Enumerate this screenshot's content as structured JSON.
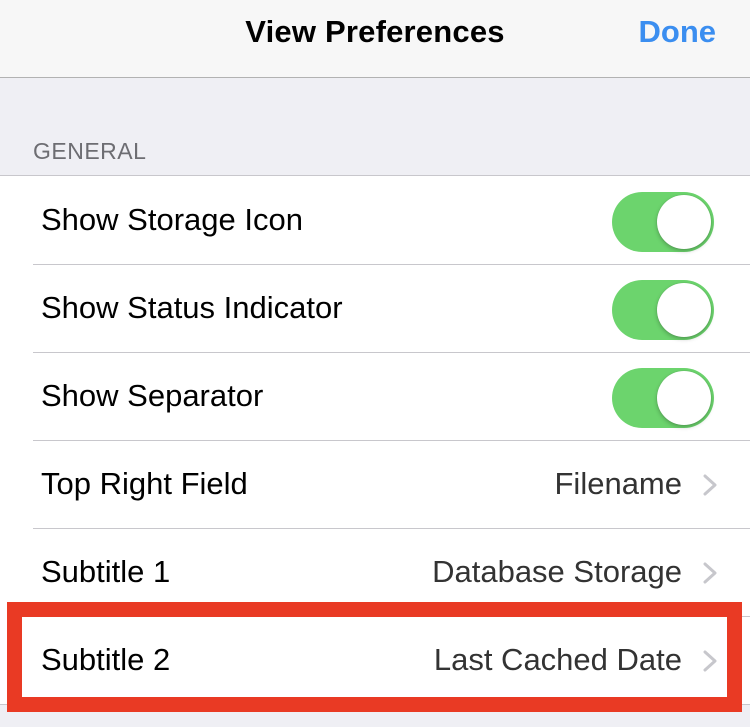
{
  "nav": {
    "title": "View Preferences",
    "done_label": "Done"
  },
  "section": {
    "header": "GENERAL"
  },
  "rows": [
    {
      "label": "Show Storage Icon",
      "type": "toggle",
      "on": true
    },
    {
      "label": "Show Status Indicator",
      "type": "toggle",
      "on": true
    },
    {
      "label": "Show Separator",
      "type": "toggle",
      "on": true
    },
    {
      "label": "Top Right Field",
      "type": "disclosure",
      "value": "Filename"
    },
    {
      "label": "Subtitle 1",
      "type": "disclosure",
      "value": "Database Storage"
    },
    {
      "label": "Subtitle 2",
      "type": "disclosure",
      "value": "Last Cached Date"
    }
  ],
  "colors": {
    "accent": "#3b8ef0",
    "toggle_on": "#6cd46d",
    "highlight": "#e93a24"
  },
  "icons": {
    "chevron": "chevron-right-icon"
  }
}
